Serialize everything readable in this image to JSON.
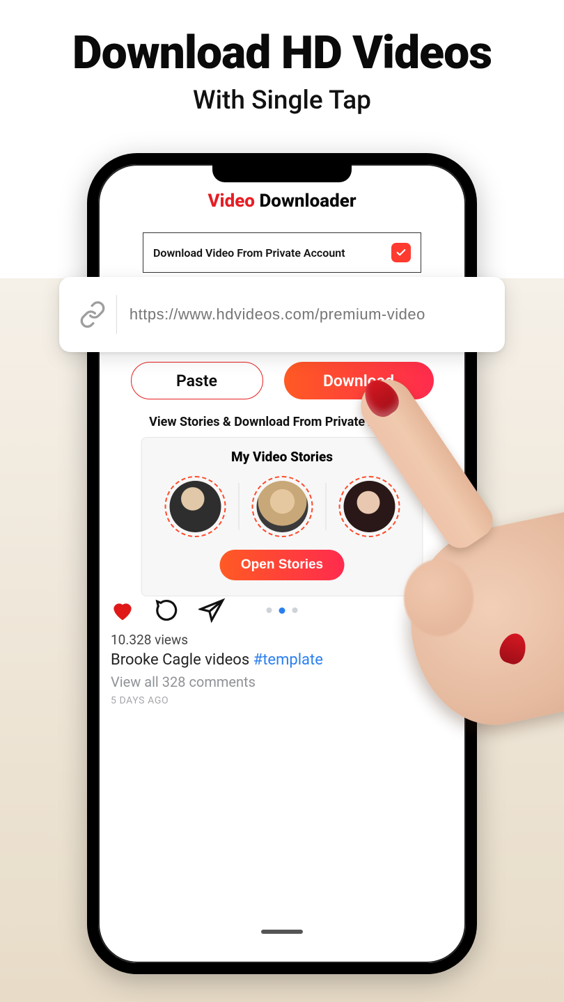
{
  "hero": {
    "title": "Download HD Videos",
    "subtitle": "With Single Tap"
  },
  "app": {
    "title_red": "Video",
    "title_black": " Downloader",
    "private_label": "Download Video From Private Account",
    "url_placeholder": "https://www.hdvideos.com/premium-video",
    "paste": "Paste",
    "download": "Download",
    "section_caption": "View Stories & Download From Private Account",
    "stories_title": "My Video Stories",
    "open_stories": "Open Stories"
  },
  "feed": {
    "views": "10.328 views",
    "caption_author": "Brooke Cagle videos ",
    "caption_tag": "#template",
    "comments": "View all 328 comments",
    "time": "5 DAYS AGO"
  }
}
